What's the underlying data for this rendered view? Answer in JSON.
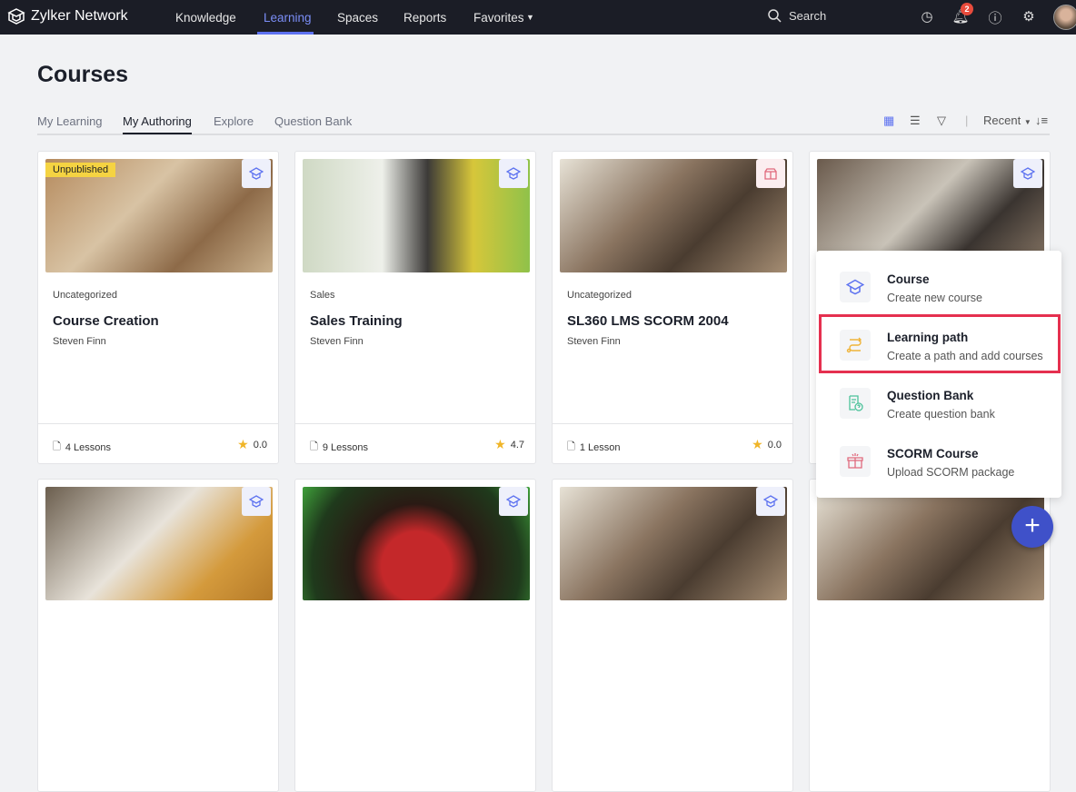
{
  "app": {
    "name": "Zylker Network"
  },
  "nav": [
    "Knowledge",
    "Learning",
    "Spaces",
    "Reports",
    "Favorites"
  ],
  "search": {
    "label": "Search"
  },
  "notifications": {
    "count": "2"
  },
  "page": {
    "title": "Courses"
  },
  "tabs": [
    "My Learning",
    "My Authoring",
    "Explore",
    "Question Bank"
  ],
  "sort": {
    "label": "Recent"
  },
  "cards": [
    {
      "badge": "Unpublished",
      "category": "Uncategorized",
      "title": "Course Creation",
      "author": "Steven Finn",
      "lessons": "4 Lessons",
      "rating": "0.0"
    },
    {
      "category": "Sales",
      "title": "Sales Training",
      "author": "Steven Finn",
      "lessons": "9 Lessons",
      "rating": "4.7"
    },
    {
      "category": "Uncategorized",
      "title": "SL360 LMS SCORM 2004",
      "author": "Steven Finn",
      "lessons": "1 Lesson",
      "rating": "0.0"
    }
  ],
  "menu": [
    {
      "title": "Course",
      "subtitle": "Create new course"
    },
    {
      "title": "Learning path",
      "subtitle": "Create a path and add courses"
    },
    {
      "title": "Question Bank",
      "subtitle": "Create question bank"
    },
    {
      "title": "SCORM Course",
      "subtitle": "Upload SCORM package"
    }
  ],
  "colors": {
    "accent": "#5d72f0",
    "highlight": "#e5304f",
    "fab": "#3f51c9"
  }
}
